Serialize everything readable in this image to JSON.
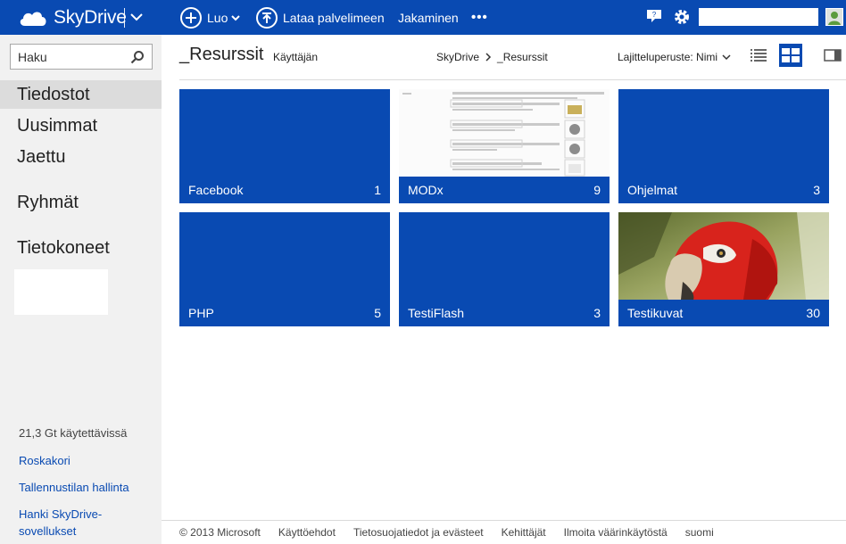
{
  "topbar": {
    "brand": "SkyDrive",
    "create_label": "Luo",
    "upload_label": "Lataa palvelimeen",
    "share_label": "Jakaminen",
    "more_label": "•••",
    "search_value": "",
    "colors": {
      "bar": "#094ab2"
    },
    "icons": [
      "cloud-logo-icon",
      "chevron-down-icon",
      "plus-circle-icon",
      "upload-circle-icon",
      "feedback-icon",
      "gear-icon",
      "avatar-icon"
    ]
  },
  "sidebar": {
    "search_placeholder": "Haku",
    "nav": [
      {
        "label": "Tiedostot",
        "selected": true
      },
      {
        "label": "Uusimmat"
      },
      {
        "label": "Jaettu"
      },
      {
        "label": "Ryhmät"
      },
      {
        "label": "Tietokoneet"
      }
    ],
    "quota_text": "21,3 Gt käytettävissä",
    "links": [
      "Roskakori",
      "Tallennustilan hallinta",
      "Hanki SkyDrive-sovellukset"
    ]
  },
  "header": {
    "folder_title": "_Resurssit",
    "owner_label": "Käyttäjän",
    "breadcrumb": [
      "SkyDrive",
      "_Resurssit"
    ],
    "sort_label": "Lajitteluperuste: Nimi",
    "view_icons": [
      "list-view-icon",
      "tiles-view-icon",
      "details-pane-icon"
    ]
  },
  "tiles": [
    {
      "name": "Facebook",
      "count": "1"
    },
    {
      "name": "MODx",
      "count": "9"
    },
    {
      "name": "Ohjelmat",
      "count": "3"
    },
    {
      "name": "PHP",
      "count": "5"
    },
    {
      "name": "TestiFlash",
      "count": "3"
    },
    {
      "name": "Testikuvat",
      "count": "30"
    }
  ],
  "footer": {
    "copyright": "© 2013 Microsoft",
    "links": [
      "Käyttöehdot",
      "Tietosuojatiedot ja evästeet",
      "Kehittäjät",
      "Ilmoita väärinkäytöstä",
      "suomi"
    ]
  }
}
